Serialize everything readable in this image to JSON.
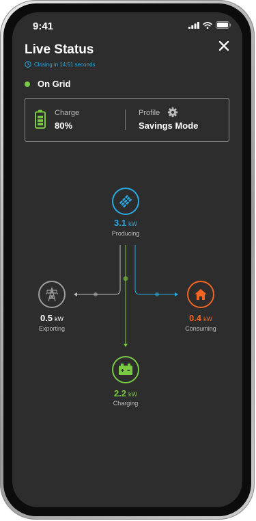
{
  "status_bar": {
    "time": "9:41"
  },
  "header": {
    "title": "Live Status",
    "countdown": "Closing in 14:51 seconds"
  },
  "grid_status": {
    "label": "On Grid",
    "color": "#7ac943"
  },
  "summary_card": {
    "charge_label": "Charge",
    "charge_value": "80%",
    "profile_label": "Profile",
    "profile_value": "Savings Mode"
  },
  "nodes": {
    "solar": {
      "value": "3.1",
      "unit": "kW",
      "caption": "Producing",
      "color": "#29a9e0",
      "icon": "solar-panel-icon"
    },
    "grid": {
      "value": "0.5",
      "unit": "kW",
      "caption": "Exporting",
      "color": "#9e9e9e",
      "icon": "power-tower-icon"
    },
    "home": {
      "value": "0.4",
      "unit": "kW",
      "caption": "Consuming",
      "color": "#f26522",
      "icon": "house-icon"
    },
    "battery": {
      "value": "2.2",
      "unit": "kW",
      "caption": "Charging",
      "color": "#7ac943",
      "icon": "battery-icon"
    }
  },
  "colors": {
    "background": "#2d2d2e",
    "accent_blue": "#29a9e0",
    "accent_green": "#7ac943",
    "accent_orange": "#f26522"
  }
}
